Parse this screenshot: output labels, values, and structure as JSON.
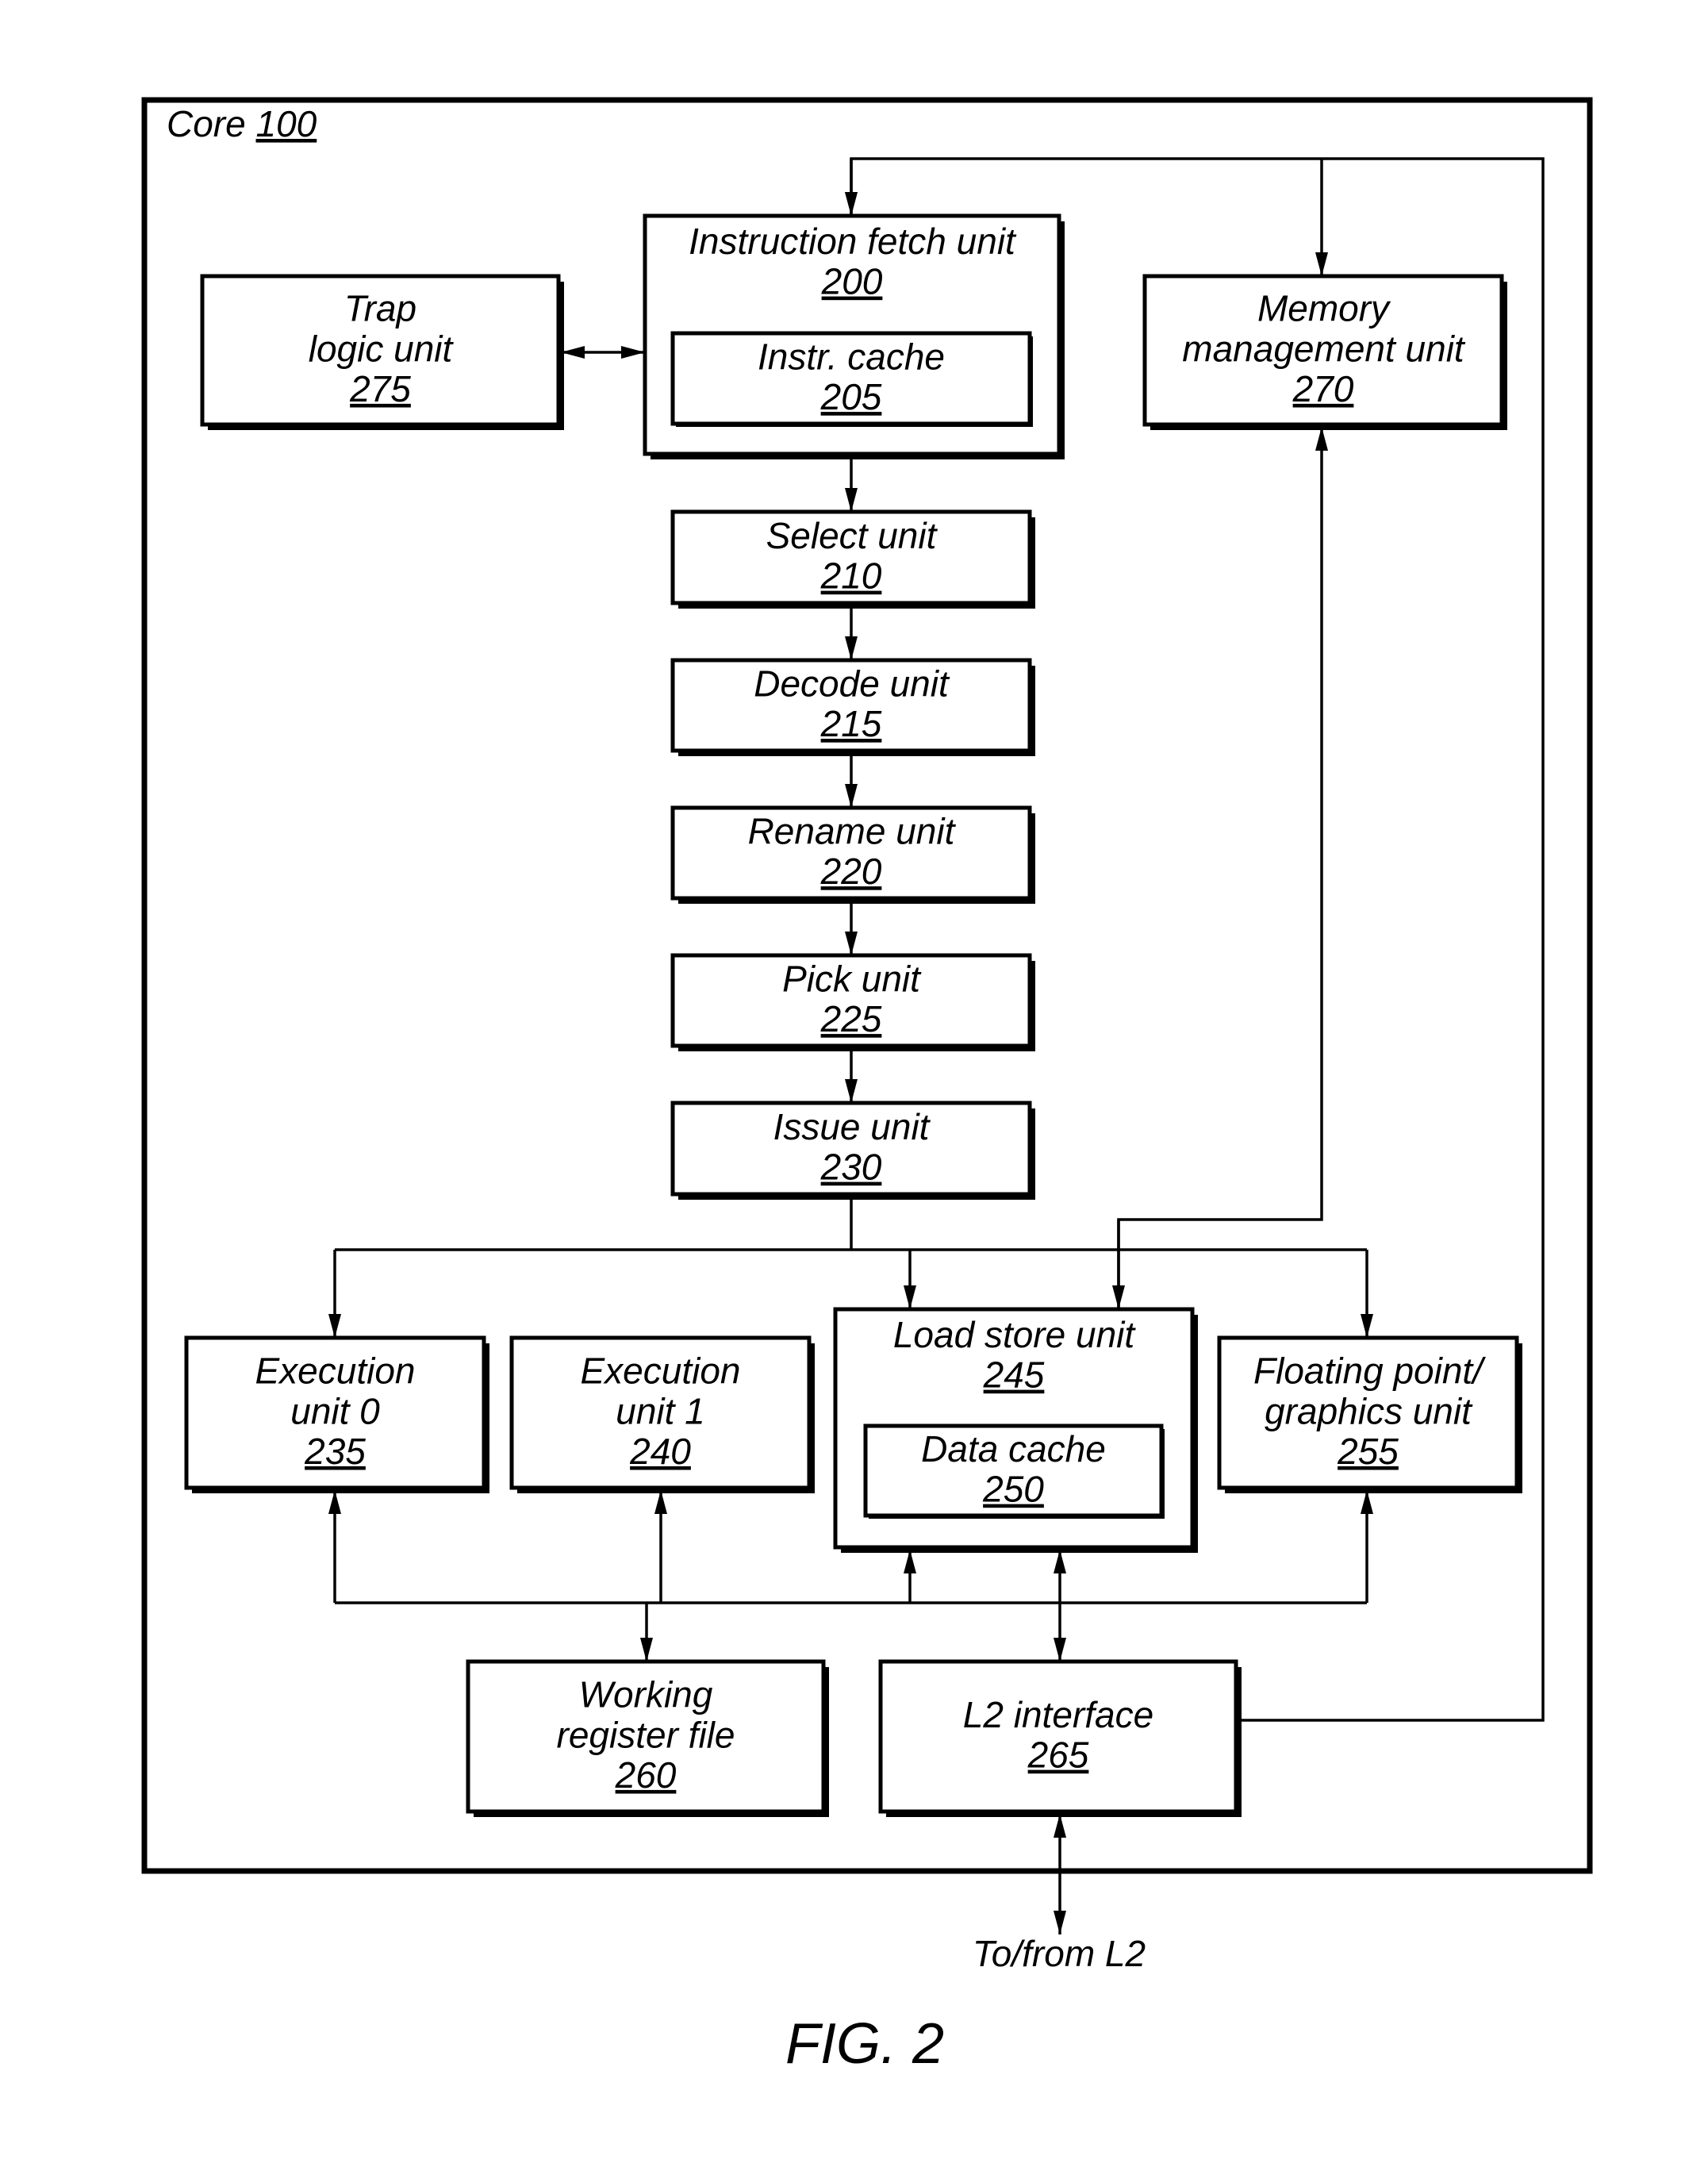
{
  "core": {
    "label": "Core",
    "ref": "100"
  },
  "units": {
    "ifu": {
      "lines": [
        "Instruction fetch unit"
      ],
      "ref": "200"
    },
    "icache": {
      "lines": [
        "Instr. cache"
      ],
      "ref": "205"
    },
    "trap": {
      "lines": [
        "Trap",
        "logic unit"
      ],
      "ref": "275"
    },
    "mmu": {
      "lines": [
        "Memory",
        "management unit"
      ],
      "ref": "270"
    },
    "select": {
      "lines": [
        "Select unit"
      ],
      "ref": "210"
    },
    "decode": {
      "lines": [
        "Decode unit"
      ],
      "ref": "215"
    },
    "rename": {
      "lines": [
        "Rename unit"
      ],
      "ref": "220"
    },
    "pick": {
      "lines": [
        "Pick unit"
      ],
      "ref": "225"
    },
    "issue": {
      "lines": [
        "Issue unit"
      ],
      "ref": "230"
    },
    "exec0": {
      "lines": [
        "Execution",
        "unit 0"
      ],
      "ref": "235"
    },
    "exec1": {
      "lines": [
        "Execution",
        "unit 1"
      ],
      "ref": "240"
    },
    "lsu": {
      "lines": [
        "Load store unit"
      ],
      "ref": "245"
    },
    "dcache": {
      "lines": [
        "Data cache"
      ],
      "ref": "250"
    },
    "fgu": {
      "lines": [
        "Floating point/",
        "graphics unit"
      ],
      "ref": "255"
    },
    "wrf": {
      "lines": [
        "Working",
        "register file"
      ],
      "ref": "260"
    },
    "l2if": {
      "lines": [
        "L2 interface"
      ],
      "ref": "265"
    }
  },
  "external_label": "To/from L2",
  "figure_caption": "FIG. 2"
}
